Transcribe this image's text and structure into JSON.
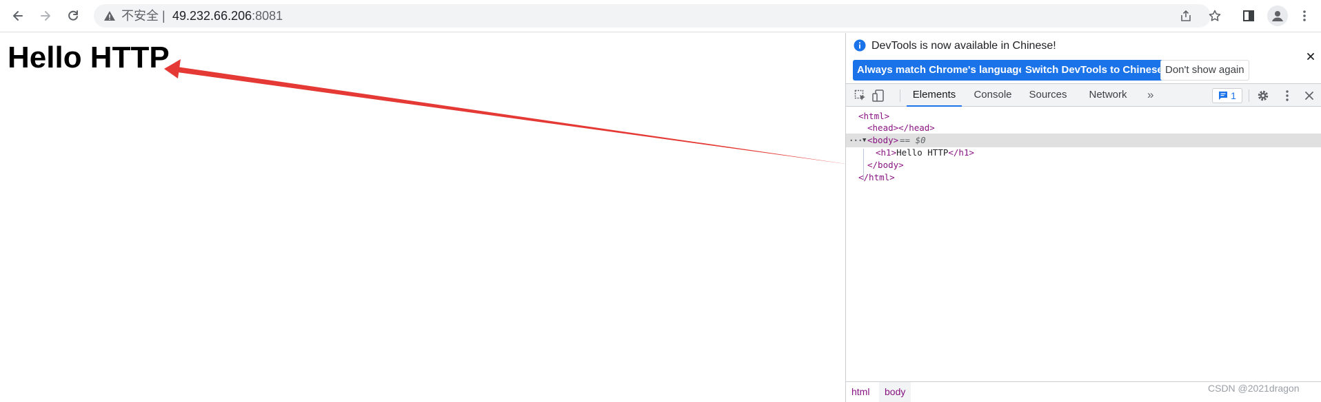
{
  "browser": {
    "security_label": "不安全",
    "url_host": "49.232.66.206",
    "url_port": ":8081",
    "icons": {
      "back": "arrow-left-icon",
      "forward": "arrow-right-icon",
      "reload": "reload-icon",
      "warning": "warning-triangle-icon",
      "share": "share-icon",
      "bookmark": "star-icon",
      "side_panel": "side-panel-icon",
      "profile": "avatar-icon",
      "menu": "kebab-menu-icon"
    }
  },
  "page": {
    "heading": "Hello HTTP"
  },
  "annotation": {
    "color": "#e53935"
  },
  "devtools": {
    "infobar": {
      "message": "DevTools is now available in Chinese!",
      "always_match_label": "Always match Chrome's language",
      "switch_label": "Switch DevTools to Chinese",
      "dont_show_label": "Don't show again"
    },
    "tabs": [
      {
        "label": "Elements",
        "active": true
      },
      {
        "label": "Console",
        "active": false
      },
      {
        "label": "Sources",
        "active": false
      },
      {
        "label": "Network",
        "active": false
      }
    ],
    "more_tabs": "»",
    "issues_count": "1",
    "tree": {
      "html_open": "<html>",
      "head": "<head></head>",
      "body_open": "<body>",
      "body_marker": "== $0",
      "h1_open": "<h1>",
      "h1_text": "Hello HTTP",
      "h1_close": "</h1>",
      "body_close": "</body>",
      "html_close": "</html>",
      "ellipsis": "···",
      "expand_marker": "▼"
    },
    "breadcrumbs": [
      "html",
      "body"
    ],
    "accent": "#1a73e8"
  },
  "watermark": "CSDN @2021dragon"
}
